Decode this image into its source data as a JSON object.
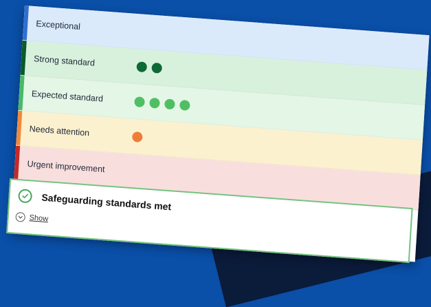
{
  "ratings": [
    {
      "label": "Exceptional",
      "dots": 0,
      "bar_color": "#2f6fcf",
      "dot_color": ""
    },
    {
      "label": "Strong standard",
      "dots": 2,
      "bar_color": "#0b5a2a",
      "dot_color": "#0d6a34"
    },
    {
      "label": "Expected standard",
      "dots": 4,
      "bar_color": "#49b86a",
      "dot_color": "#4fbf63"
    },
    {
      "label": "Needs attention",
      "dots": 1,
      "bar_color": "#f08a3c",
      "dot_color": "#f07c3a"
    },
    {
      "label": "Urgent improvement",
      "dots": 0,
      "bar_color": "#c62828",
      "dot_color": ""
    }
  ],
  "safeguarding": {
    "title": "Safeguarding standards met",
    "icon": "check-circle-icon",
    "show_label": "Show",
    "border_color": "#74c27f"
  },
  "background_color": "#0a4fa8"
}
